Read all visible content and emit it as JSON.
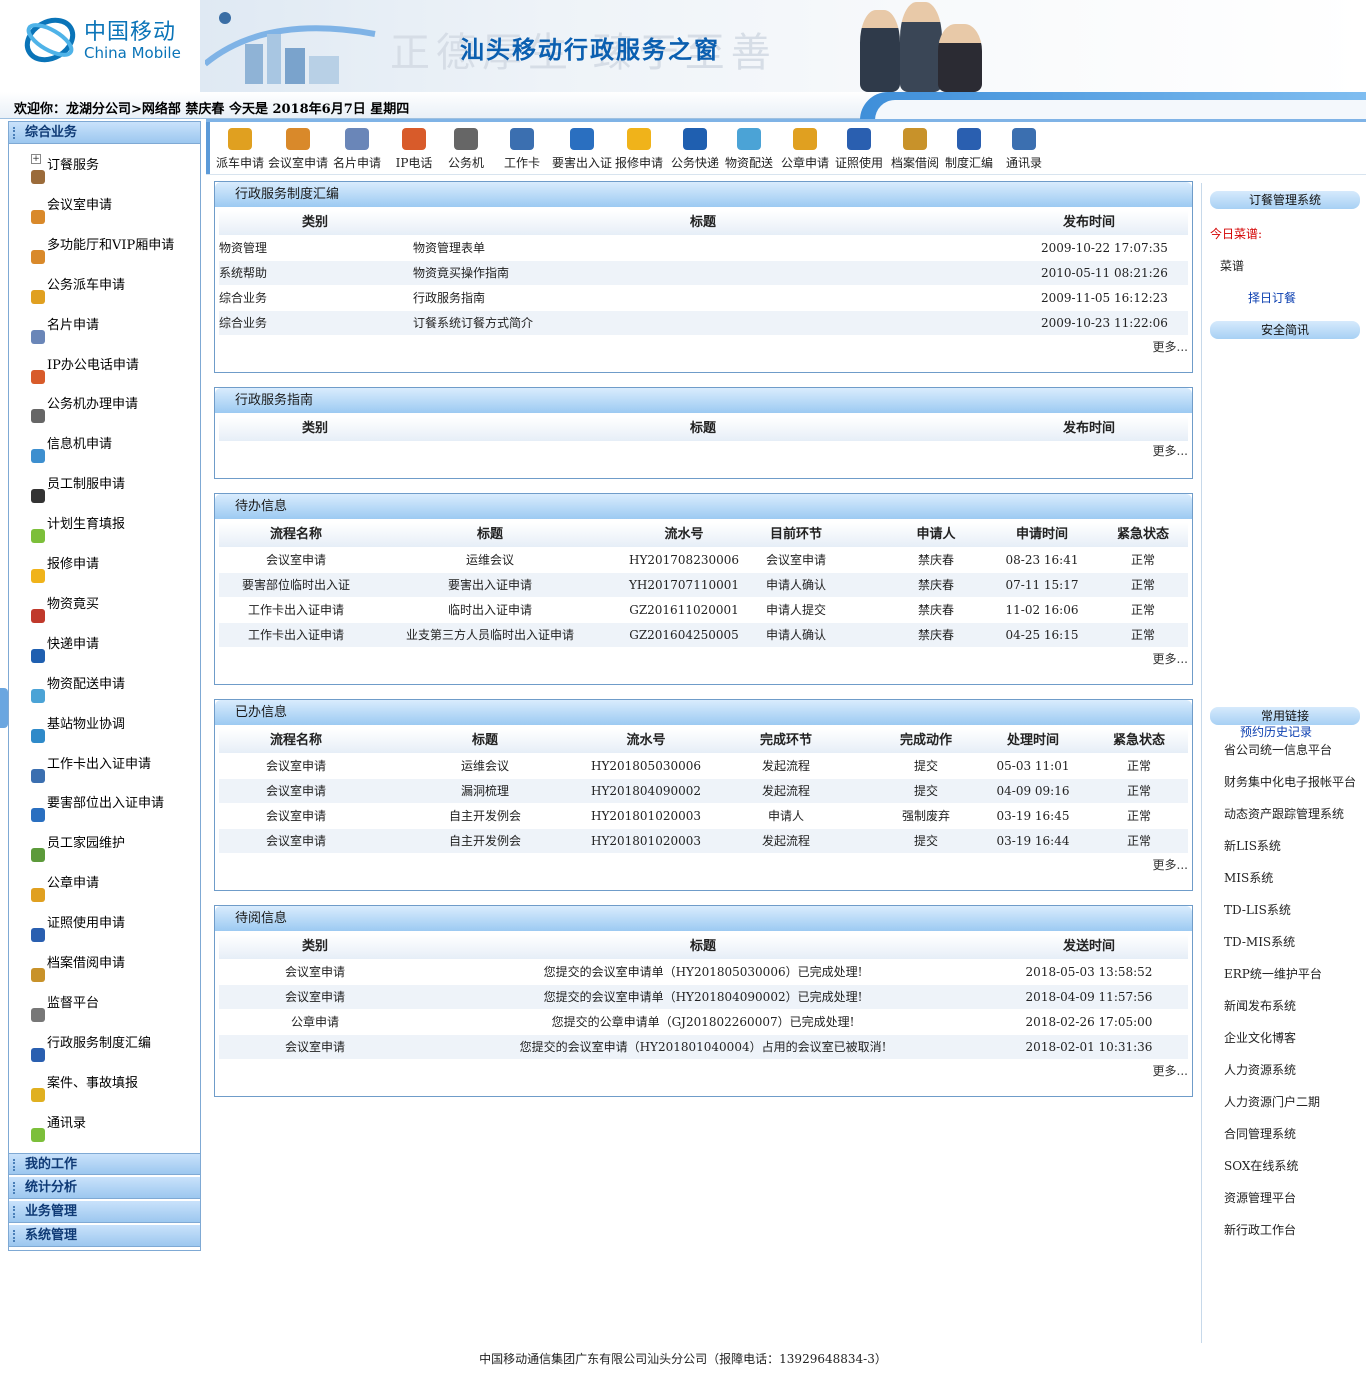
{
  "header": {
    "logo_cn": "中国移动",
    "logo_en": "China Mobile",
    "banner_title": "汕头移动行政服务之窗",
    "banner_watermark": "正德厚生 臻于至善"
  },
  "welcome": "欢迎你：龙湖分公司>网络部 禁庆春 今天是 2018年6月7日 星期四",
  "sidebar": {
    "sections": [
      "综合业务",
      "我的工作",
      "统计分析",
      "业务管理",
      "系统管理"
    ],
    "items": [
      {
        "label": "订餐服务",
        "icon": "coffee-icon",
        "color": "#9b6b3a"
      },
      {
        "label": "会议室申请",
        "icon": "people-icon",
        "color": "#d9892a"
      },
      {
        "label": "多功能厅和VIP厢申请",
        "icon": "people-icon",
        "color": "#d9892a"
      },
      {
        "label": "公务派车申请",
        "icon": "car-icon",
        "color": "#e0a020"
      },
      {
        "label": "名片申请",
        "icon": "card-icon",
        "color": "#6a86b8"
      },
      {
        "label": "IP办公电话申请",
        "icon": "phone-icon",
        "color": "#d85b2a"
      },
      {
        "label": "公务机办理申请",
        "icon": "mobile-icon",
        "color": "#666666"
      },
      {
        "label": "信息机申请",
        "icon": "device-icon",
        "color": "#3d8fcf"
      },
      {
        "label": "员工制服申请",
        "icon": "uniform-icon",
        "color": "#333333"
      },
      {
        "label": "计划生育填报",
        "icon": "form-icon",
        "color": "#7cbf3a"
      },
      {
        "label": "报修申请",
        "icon": "gear-icon",
        "color": "#f0b31a"
      },
      {
        "label": "物资竟买",
        "icon": "hammer-icon",
        "color": "#c0392b"
      },
      {
        "label": "快递申请",
        "icon": "ems-icon",
        "color": "#1f5fb0"
      },
      {
        "label": "物资配送申请",
        "icon": "boxes-icon",
        "color": "#4ba3d6"
      },
      {
        "label": "基站物业协调",
        "icon": "tower-icon",
        "color": "#2f8ac9"
      },
      {
        "label": "工作卡出入证申请",
        "icon": "id-card-icon",
        "color": "#3b6fb0"
      },
      {
        "label": "要害部位出入证申请",
        "icon": "calendar-icon",
        "color": "#2a6fc0"
      },
      {
        "label": "员工家园维护",
        "icon": "home-icon",
        "color": "#5c9a3a"
      },
      {
        "label": "公章申请",
        "icon": "stamp-icon",
        "color": "#e0a020"
      },
      {
        "label": "证照使用申请",
        "icon": "grid-icon",
        "color": "#2a5fb0"
      },
      {
        "label": "档案借阅申请",
        "icon": "folder-icon",
        "color": "#c8922a"
      },
      {
        "label": "监督平台",
        "icon": "lock-icon",
        "color": "#777777"
      },
      {
        "label": "行政服务制度汇编",
        "icon": "book-icon",
        "color": "#2a5fb0"
      },
      {
        "label": "案件、事故填报",
        "icon": "warning-icon",
        "color": "#e0b020"
      },
      {
        "label": "通讯录",
        "icon": "contacts-icon",
        "color": "#7cbf3a"
      }
    ]
  },
  "toolbar": [
    {
      "label": "派车申请",
      "icon": "car-icon",
      "color": "#e0a020"
    },
    {
      "label": "会议室申请",
      "icon": "people-icon",
      "color": "#d9892a"
    },
    {
      "label": "名片申请",
      "icon": "card-icon",
      "color": "#6a86b8"
    },
    {
      "label": "IP电话",
      "icon": "phone-icon",
      "color": "#d85b2a"
    },
    {
      "label": "公务机",
      "icon": "mobile-icon",
      "color": "#666666"
    },
    {
      "label": "工作卡",
      "icon": "id-card-icon",
      "color": "#3b6fb0"
    },
    {
      "label": "要害出入证",
      "icon": "calendar-icon",
      "color": "#2a6fc0"
    },
    {
      "label": "报修申请",
      "icon": "gear-icon",
      "color": "#f0b31a"
    },
    {
      "label": "公务快递",
      "icon": "ems-icon",
      "color": "#1f5fb0"
    },
    {
      "label": "物资配送",
      "icon": "boxes-icon",
      "color": "#4ba3d6"
    },
    {
      "label": "公章申请",
      "icon": "stamp-icon",
      "color": "#e0a020"
    },
    {
      "label": "证照使用",
      "icon": "grid-icon",
      "color": "#2a5fb0"
    },
    {
      "label": "档案借阅",
      "icon": "folder-icon",
      "color": "#c8922a"
    },
    {
      "label": "制度汇编",
      "icon": "book-icon",
      "color": "#2a5fb0"
    },
    {
      "label": "通讯录",
      "icon": "contacts-icon",
      "color": "#3b6fb0"
    }
  ],
  "panels": {
    "regulations": {
      "title": "行政服务制度汇编",
      "headers": [
        "类别",
        "标题",
        "发布时间"
      ],
      "rows": [
        [
          "物资管理",
          "物资管理表单",
          "2009-10-22 17:07:35"
        ],
        [
          "系统帮助",
          "物资竟买操作指南",
          "2010-05-11 08:21:26"
        ],
        [
          "综合业务",
          "行政服务指南",
          "2009-11-05 16:12:23"
        ],
        [
          "综合业务",
          "订餐系统订餐方式简介",
          "2009-10-23 11:22:06"
        ]
      ],
      "more": "更多..."
    },
    "guide": {
      "title": "行政服务指南",
      "headers": [
        "类别",
        "标题",
        "发布时间"
      ],
      "rows": [],
      "more": "更多..."
    },
    "todo": {
      "title": "待办信息",
      "headers": [
        "流程名称",
        "标题",
        "流水号",
        "目前环节",
        "申请人",
        "申请时间",
        "紧急状态"
      ],
      "rows": [
        [
          "会议室申请",
          "运维会议",
          "HY201708230006",
          "会议室申请",
          "禁庆春",
          "08-23 16:41",
          "正常"
        ],
        [
          "要害部位临时出入证",
          "要害出入证申请",
          "YH201707110001",
          "申请人确认",
          "禁庆春",
          "07-11 15:17",
          "正常"
        ],
        [
          "工作卡出入证申请",
          "临时出入证申请",
          "GZ201611020001",
          "申请人提交",
          "禁庆春",
          "11-02 16:06",
          "正常"
        ],
        [
          "工作卡出入证申请",
          "业支第三方人员临时出入证申请",
          "GZ201604250005",
          "申请人确认",
          "禁庆春",
          "04-25 16:15",
          "正常"
        ]
      ],
      "more": "更多..."
    },
    "done": {
      "title": "已办信息",
      "headers": [
        "流程名称",
        "标题",
        "流水号",
        "完成环节",
        "完成动作",
        "处理时间",
        "紧急状态"
      ],
      "rows": [
        [
          "会议室申请",
          "运维会议",
          "HY201805030006",
          "发起流程",
          "提交",
          "05-03 11:01",
          "正常"
        ],
        [
          "会议室申请",
          "漏洞梳理",
          "HY201804090002",
          "发起流程",
          "提交",
          "04-09 09:16",
          "正常"
        ],
        [
          "会议室申请",
          "自主开发例会",
          "HY201801020003",
          "申请人",
          "强制废弃",
          "03-19 16:45",
          "正常"
        ],
        [
          "会议室申请",
          "自主开发例会",
          "HY201801020003",
          "发起流程",
          "提交",
          "03-19 16:44",
          "正常"
        ]
      ],
      "more": "更多..."
    },
    "toread": {
      "title": "待阅信息",
      "headers": [
        "类别",
        "标题",
        "发送时间"
      ],
      "rows": [
        [
          "会议室申请",
          "您提交的会议室申请单（HY201805030006）已完成处理!",
          "2018-05-03 13:58:52"
        ],
        [
          "会议室申请",
          "您提交的会议室申请单（HY201804090002）已完成处理!",
          "2018-04-09 11:57:56"
        ],
        [
          "公章申请",
          "您提交的公章申请单（GJ201802260007）已完成处理!",
          "2018-02-26 17:05:00"
        ],
        [
          "会议室申请",
          "您提交的会议室申请（HY201801040004）占用的会议室已被取消!",
          "2018-02-01 10:31:36"
        ]
      ],
      "more": "更多..."
    }
  },
  "right": {
    "order_title": "订餐管理系统",
    "today_menu": "今日菜谱:",
    "menu": "菜谱",
    "order_link": "择日订餐",
    "safety_title": "安全简讯",
    "links_title": "常用链接",
    "history_link": "预约历史记录",
    "links": [
      "省公司统一信息平台",
      "财务集中化电子报帐平台",
      "动态资产跟踪管理系统",
      "新LIS系统",
      "MIS系统",
      "TD-LIS系统",
      "TD-MIS系统",
      "ERP统一维护平台",
      "新闻发布系统",
      "企业文化博客",
      "人力资源系统",
      "人力资源门户二期",
      "合同管理系统",
      "SOX在线系统",
      "资源管理平台",
      "新行政工作台"
    ]
  },
  "footer": "中国移动通信集团广东有限公司汕头分公司（报障电话：13929648834-3）"
}
